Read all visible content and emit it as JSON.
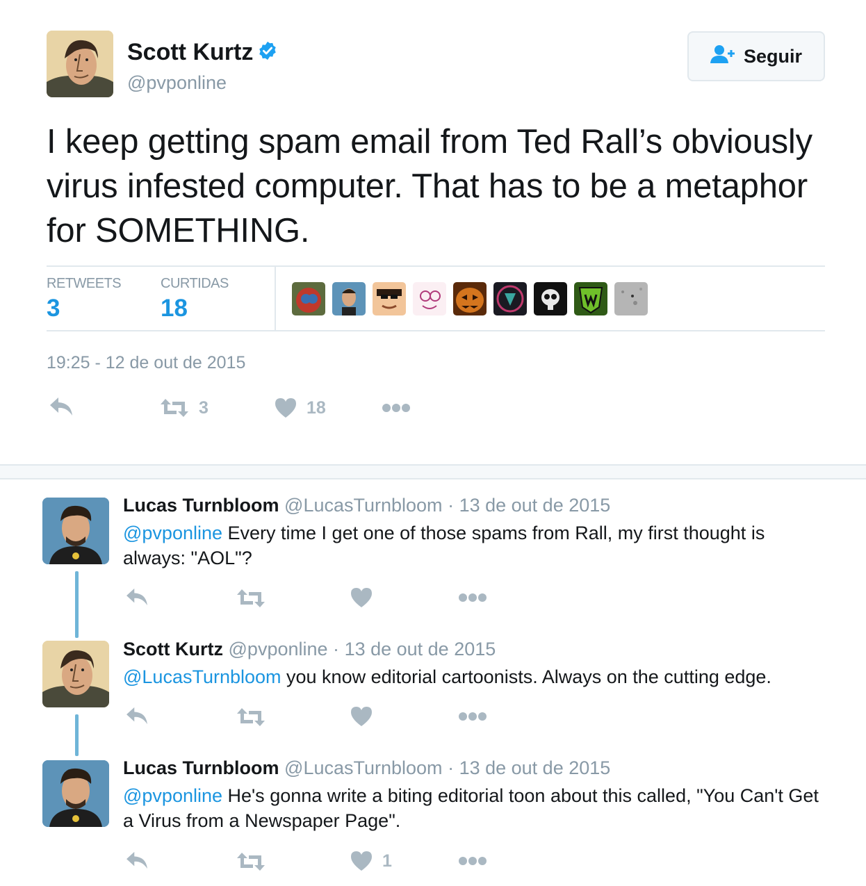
{
  "main_tweet": {
    "author_name": "Scott Kurtz",
    "author_handle": "@pvponline",
    "follow_label": "Seguir",
    "text": "I keep getting spam email from Ted Rall’s obviously virus infested computer. That has to be a metaphor for SOMETHING.",
    "stats": {
      "retweets_label": "RETWEETS",
      "retweets_value": "3",
      "likes_label": "CURTIDAS",
      "likes_value": "18"
    },
    "timestamp": "19:25 - 12 de out de 2015",
    "actions": {
      "retweet_count": "3",
      "like_count": "18"
    }
  },
  "replies": [
    {
      "name": "Lucas Turnbloom",
      "handle": "@LucasTurnbloom",
      "separator": "·",
      "date": "13 de out de 2015",
      "mention": "@pvponline",
      "text": " Every time I get one of those spams from Rall, my first thought is always: \"AOL\"?",
      "like_count": ""
    },
    {
      "name": "Scott Kurtz",
      "handle": "@pvponline",
      "separator": "·",
      "date": "13 de out de 2015",
      "mention": "@LucasTurnbloom",
      "text": " you know editorial cartoonists. Always on the cutting edge.",
      "like_count": ""
    },
    {
      "name": "Lucas Turnbloom",
      "handle": "@LucasTurnbloom",
      "separator": "·",
      "date": "13 de out de 2015",
      "mention": "@pvponline",
      "text": " He's gonna write a biting editorial toon about this called, \"You Can't Get a Virus from a Newspaper Page\".",
      "like_count": "1"
    }
  ],
  "colors": {
    "link": "#1b95e0",
    "muted": "#8899a6",
    "action_icon": "#aab8c2",
    "thread_line": "#6fb5d8"
  },
  "icons": [
    "verified-icon",
    "follow-user-icon",
    "reply-icon",
    "retweet-icon",
    "heart-icon",
    "more-icon"
  ]
}
